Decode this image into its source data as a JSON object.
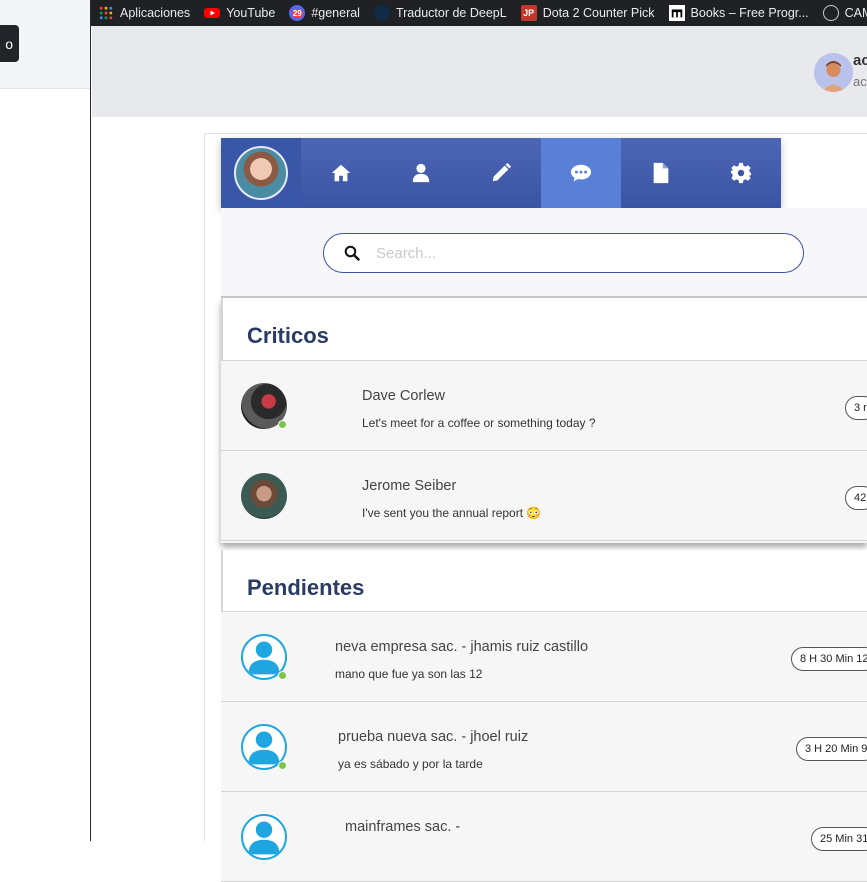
{
  "bookmarks": [
    {
      "label": "Aplicaciones",
      "icon": "apps-grid-icon",
      "color": "#e8453c"
    },
    {
      "label": "YouTube",
      "icon": "youtube-icon",
      "color": "#ff0000"
    },
    {
      "label": "#general",
      "icon": "discord-icon",
      "color": "#5865f2",
      "badge": "29"
    },
    {
      "label": "Traductor de DeepL",
      "icon": "deepl-icon",
      "color": "#0f2b46"
    },
    {
      "label": "Dota 2 Counter Pick",
      "icon": "dota-icon",
      "color": "#c0392b"
    },
    {
      "label": "Books – Free Progr...",
      "icon": "books-icon",
      "color": "#ffffff"
    },
    {
      "label": "CAM",
      "icon": "cam-icon",
      "color": "#cccccc"
    }
  ],
  "left_button": {
    "label": "o"
  },
  "user": {
    "name": "ac",
    "role": "ac"
  },
  "nav": {
    "items": [
      "home-icon",
      "user-icon",
      "pencil-icon",
      "chat-icon",
      "document-icon",
      "gear-icon"
    ],
    "active": "chat-icon"
  },
  "search": {
    "placeholder": "Search..."
  },
  "sections": {
    "criticos": {
      "title": "Criticos",
      "rows": [
        {
          "name": "Dave Corlew",
          "message": "Let's meet for a coffee or something today ?",
          "time": "3 r",
          "online": true
        },
        {
          "name": "Jerome Seiber",
          "message": "I've sent you the annual report 😳",
          "time": "42",
          "online": false
        }
      ]
    },
    "pendientes": {
      "title": "Pendientes",
      "rows": [
        {
          "name": "neva empresa sac. - jhamis ruiz castillo",
          "message": "mano que fue ya son las 12",
          "time": "8 H 30 Min 12",
          "online": true
        },
        {
          "name": "prueba nueva sac. - jhoel ruiz",
          "message": "ya es sábado y por la tarde",
          "time": "3 H 20 Min 9",
          "online": true
        },
        {
          "name": "mainframes sac. -",
          "message": "",
          "time": "25 Min 31",
          "online": false
        }
      ]
    }
  },
  "colors": {
    "nav": "#3a54a5",
    "nav_active": "#5a7fd6",
    "section_title": "#2a3c63",
    "online": "#7cc34a",
    "avatar_ring": "#1fa6e0"
  }
}
